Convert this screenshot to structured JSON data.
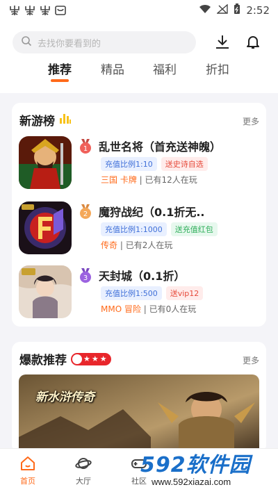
{
  "status_bar": {
    "time": "2:52"
  },
  "search": {
    "placeholder": "去找你要看到的"
  },
  "tabs": [
    {
      "label": "推荐",
      "active": true
    },
    {
      "label": "精品"
    },
    {
      "label": "福利"
    },
    {
      "label": "折扣"
    }
  ],
  "new_games": {
    "title": "新游榜",
    "more": "更多",
    "items": [
      {
        "rank": "1",
        "name": "乱世名将（首充送神魄）",
        "tags": [
          {
            "text": "充值比例1:10",
            "style": "blue"
          },
          {
            "text": "送史诗自选",
            "style": "red"
          }
        ],
        "categories": "三国 卡牌",
        "players": "已有12人在玩",
        "medal_color": "#f0605a"
      },
      {
        "rank": "2",
        "name": "魔狩战纪（0.1折无..",
        "tags": [
          {
            "text": "充值比例1:1000",
            "style": "blue"
          },
          {
            "text": "送充值红包",
            "style": "green"
          }
        ],
        "categories": "传奇",
        "players": "已有2人在玩",
        "medal_color": "#f4a85a"
      },
      {
        "rank": "3",
        "name": "天封城（0.1折）",
        "tags": [
          {
            "text": "充值比例1:500",
            "style": "blue"
          },
          {
            "text": "送vip12",
            "style": "red"
          }
        ],
        "categories": "MMO 冒险",
        "players": "已有0人在玩",
        "medal_color": "#9b62e0"
      }
    ]
  },
  "hot": {
    "title": "爆款推荐",
    "more": "更多",
    "banner_text": "新水浒传奇"
  },
  "bottom_nav": [
    {
      "label": "首页",
      "active": true
    },
    {
      "label": "大厅"
    },
    {
      "label": "社区"
    }
  ],
  "watermark": {
    "brand": "592软件园",
    "url": "www.592xiazai.com"
  },
  "colors": {
    "accent": "#ff6a1a",
    "rating_red": "#e8262b",
    "watermark_blue": "#1a6fc9"
  }
}
